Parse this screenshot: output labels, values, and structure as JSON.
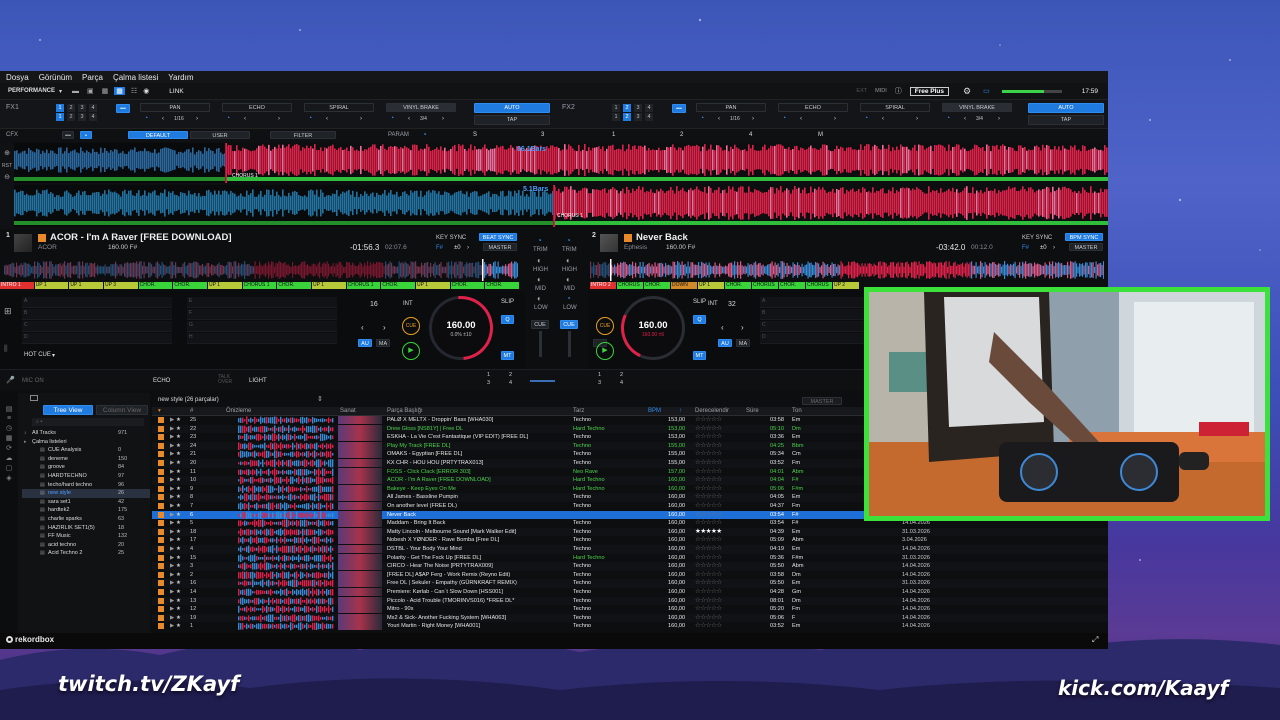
{
  "menu": [
    "Dosya",
    "Görünüm",
    "Parça",
    "Çalma listesi",
    "Yardım"
  ],
  "toolbar": {
    "mode": "PERFORMANCE",
    "link": "LINK",
    "free_plus": "Free Plus",
    "clock": "17:59",
    "midi": "MIDI",
    "ext": "EXT"
  },
  "fx1": {
    "label": "FX1",
    "effects": [
      "PAN",
      "ECHO",
      "SPIRAL",
      "VINYL BRAKE"
    ],
    "beat": "1/16",
    "beat2": "3/4",
    "auto": "AUTO",
    "tap": "TAP",
    "nums": [
      "1",
      "2",
      "3",
      "4",
      "1",
      "2",
      "3",
      "4"
    ]
  },
  "fx2": {
    "label": "FX2",
    "effects": [
      "PAN",
      "ECHO",
      "SPIRAL",
      "VINYL BRAKE"
    ],
    "beat": "1/16",
    "beat2": "3/4",
    "auto": "AUTO",
    "tap": "TAP"
  },
  "cfx": {
    "label": "CFX",
    "default": "DEFAULT",
    "user": "USER",
    "filter": "FILTER",
    "param": "PARAM",
    "s": "S",
    "m": "M",
    "nums": [
      "3",
      "1",
      "2",
      "4"
    ]
  },
  "waves": {
    "top_bars": "86.1Bars",
    "bot_bars": "5.1Bars",
    "top_chorus": "CHORUS 1",
    "bot_chorus": "CHORUS 1"
  },
  "deck1": {
    "num": "1",
    "title": "ACOR - I'm A Raver [FREE DOWNLOAD]",
    "artist": "ACOR",
    "bpm_key": "160.00 F#",
    "remain": "-01:56.3",
    "total": "02:07.6",
    "keysync": "KEY SYNC",
    "beatsync": "BEAT SYNC",
    "master": "MASTER",
    "bpm": "160.00",
    "pct": "0.0% ±10",
    "cue": "CUE",
    "loop": "16",
    "int": "INT",
    "slip": "SLIP",
    "q": "Q",
    "au": "AU",
    "ma": "MA",
    "mt": "MT",
    "hotcue": "HOT CUE"
  },
  "deck2": {
    "num": "2",
    "title": "Never Back",
    "artist": "Ephesis",
    "bpm_key": "160.00 F#",
    "remain": "-03:42.0",
    "total": "00:12.0",
    "keysync": "KEY SYNC",
    "beatsync": "BPM SYNC",
    "master": "MASTER",
    "bpm": "160.00",
    "pct": "160.00 ±6",
    "cue": "CUE",
    "loop": "32",
    "int": "INT",
    "slip": "SLIP",
    "q": "Q",
    "au": "AU",
    "ma": "MA",
    "mt": "MT"
  },
  "mixer": {
    "trim": "TRIM",
    "high": "HIGH",
    "mid": "MID",
    "low": "LOW",
    "cue": "CUE"
  },
  "cuebar1": [
    "INTRO 1",
    "UP 1",
    "UP 1",
    "UP 3",
    "CHOR.",
    "CHOR.",
    "UP 1",
    "CHORUS 1",
    "CHOR.",
    "UP 1",
    "CHORUS 1",
    "CHOR.",
    "UP 1",
    "CHOR.",
    "CHOR."
  ],
  "cuebar2": [
    "INTRO 2",
    "CHORUS 1",
    "CHOR.",
    "DOWN",
    "UP 1",
    "CHOR.",
    "CHORUS 1",
    "CHOR.",
    "CHORUS 1",
    "UP 2"
  ],
  "pads": {
    "left": [
      "A",
      "B",
      "C",
      "D"
    ],
    "left2": [
      "E",
      "F",
      "G",
      "H"
    ],
    "right": [
      "A",
      "B",
      "C",
      "D"
    ]
  },
  "bottomstrip": {
    "mic": "MIC ON",
    "echo": "ECHO",
    "light": "LIGHT",
    "talkover": "TALK OVER",
    "nums": [
      "1",
      "2",
      "3",
      "4",
      "1",
      "2",
      "3",
      "4"
    ]
  },
  "browser": {
    "tree_view": "Tree View",
    "column_view": "Column View",
    "playlist_title": "new style (26 parçalar)",
    "master": "MASTER",
    "headers": {
      "num": "#",
      "preview": "Önizleme",
      "artwork": "Sanat",
      "title": "Parça Başlığı",
      "genre": "Tarz",
      "bpm": "BPM",
      "rating": "Derecelendir",
      "time": "Süre",
      "key": "Ton"
    },
    "sidebar": [
      {
        "name": "All Tracks",
        "count": "971"
      },
      {
        "name": "Çalma listeleri",
        "count": ""
      },
      {
        "name": "CUE Analysis",
        "count": "0"
      },
      {
        "name": "deneme",
        "count": "150"
      },
      {
        "name": "groove",
        "count": "84"
      },
      {
        "name": "HARDTECHNO",
        "count": "97"
      },
      {
        "name": "techo/hard techno",
        "count": "96"
      },
      {
        "name": "new style",
        "count": "26"
      },
      {
        "name": "sara set1",
        "count": "42"
      },
      {
        "name": "hardtek2",
        "count": "175"
      },
      {
        "name": "charlie sparks",
        "count": "63"
      },
      {
        "name": "HAZIRLIK SET1(5)",
        "count": "18"
      },
      {
        "name": "FF Music",
        "count": "132"
      },
      {
        "name": "acid techno",
        "count": "20"
      },
      {
        "name": "Acid Techno 2",
        "count": "25"
      }
    ],
    "rows": [
      {
        "n": "25",
        "title": "PALØ X MELTX - Droppin' Bass [WHA030]",
        "genre": "Techno",
        "bpm": "153,00",
        "time": "03:58",
        "key": "Em",
        "date": "",
        "stars": 0,
        "c": "w"
      },
      {
        "n": "22",
        "title": "Drew Gloss [NS81Y] | Free DL",
        "genre": "Hard Techno",
        "bpm": "153,00",
        "time": "05:10",
        "key": "Dm",
        "date": "",
        "stars": 0,
        "c": "g"
      },
      {
        "n": "23",
        "title": "ESKHA - La Vie C'est Fantastique (VIP EDIT) [FREE DL]",
        "genre": "Techno",
        "bpm": "153,00",
        "time": "03:36",
        "key": "Em",
        "date": "",
        "stars": 0,
        "c": "w"
      },
      {
        "n": "24",
        "title": "Play My Track [FREE DL]",
        "genre": "Techno",
        "bpm": "155,00",
        "time": "04:25",
        "key": "Bbm",
        "date": "",
        "stars": 0,
        "c": "g"
      },
      {
        "n": "21",
        "title": "OMAKS - Egyptian [FREE DL]",
        "genre": "Techno",
        "bpm": "155,00",
        "time": "05:34",
        "key": "Cm",
        "date": "",
        "stars": 0,
        "c": "w"
      },
      {
        "n": "20",
        "title": "KX CHR - HOU HOU [PRTYTRAX013]",
        "genre": "Techno",
        "bpm": "155,00",
        "time": "03:52",
        "key": "Fm",
        "date": "",
        "stars": 0,
        "c": "w"
      },
      {
        "n": "11",
        "title": "FOSS - Click Clack [ERROR 303]",
        "genre": "Neo Rave",
        "bpm": "157,00",
        "time": "04:01",
        "key": "Abm",
        "date": "",
        "stars": 0,
        "c": "g"
      },
      {
        "n": "10",
        "title": "ACOR - I'm A Raver [FREE DOWNLOAD]",
        "genre": "Hard Techno",
        "bpm": "160,00",
        "time": "04:04",
        "key": "F#",
        "date": "",
        "stars": 0,
        "c": "g"
      },
      {
        "n": "9",
        "title": "Bakeye - Keep Eyes On Me",
        "genre": "Hard Techno",
        "bpm": "160,00",
        "time": "05:06",
        "key": "F#m",
        "date": "",
        "stars": 0,
        "c": "g"
      },
      {
        "n": "8",
        "title": "All James - Bassline Pumpin",
        "genre": "Techno",
        "bpm": "160,00",
        "time": "04:05",
        "key": "Em",
        "date": "",
        "stars": 0,
        "c": "w"
      },
      {
        "n": "7",
        "title": "On another level (FREE DL)",
        "genre": "Techno",
        "bpm": "160,00",
        "time": "04:37",
        "key": "Fm",
        "date": "",
        "stars": 0,
        "c": "w"
      },
      {
        "n": "6",
        "title": "Never Back",
        "genre": "",
        "bpm": "160,00",
        "time": "03:54",
        "key": "F#",
        "date": "",
        "stars": 0,
        "c": "sel"
      },
      {
        "n": "5",
        "title": "Maddam - Bring It Back",
        "genre": "Techno",
        "bpm": "160,00",
        "time": "03:54",
        "key": "F#",
        "date": "14.04.2026",
        "stars": 0,
        "c": "w"
      },
      {
        "n": "18",
        "title": "Matty Lincoln - Melbourne Sound [Mark Walker Edit]",
        "genre": "Techno",
        "bpm": "160,00",
        "time": "04:39",
        "key": "Em",
        "date": "31.03.2026",
        "stars": 5,
        "c": "w"
      },
      {
        "n": "17",
        "title": "Nobesh X YØNDER - Rave Bomba [Free DL]",
        "genre": "Techno",
        "bpm": "160,00",
        "time": "05:09",
        "key": "Abm",
        "date": "3.04.2026",
        "stars": 0,
        "c": "w"
      },
      {
        "n": "4",
        "title": "DSTBL - Your Body Your Mind",
        "genre": "Techno",
        "bpm": "160,00",
        "time": "04:19",
        "key": "Em",
        "date": "14.04.2026",
        "stars": 0,
        "c": "w"
      },
      {
        "n": "15",
        "title": "Polarity - Get The Fxck Up [FREE DL]",
        "genre": "Hard Techno",
        "bpm": "160,00",
        "time": "05:36",
        "key": "F#m",
        "date": "31.03.2026",
        "stars": 0,
        "c": "w"
      },
      {
        "n": "3",
        "title": "CIRCO - Hear The Noise [PRTYTRAX009]",
        "genre": "Techno",
        "bpm": "160,00",
        "time": "05:50",
        "key": "Abm",
        "date": "14.04.2026",
        "stars": 0,
        "c": "w"
      },
      {
        "n": "2",
        "title": "[FREE DL] A$AP Ferg - Work Remix (Reyno Edit)",
        "genre": "Techno",
        "bpm": "160,00",
        "time": "03:58",
        "key": "Dm",
        "date": "14.04.2026",
        "stars": 0,
        "c": "w"
      },
      {
        "n": "16",
        "title": "Free DL | Sekuler - Empathy (GÜRNKRAFT REMIX)",
        "genre": "Techno",
        "bpm": "160,00",
        "time": "05:50",
        "key": "Em",
        "date": "31.03.2026",
        "stars": 0,
        "c": "w"
      },
      {
        "n": "14",
        "title": "Premiere: Kørlab - Can´t Slow Down [HSS001]",
        "genre": "Techno",
        "bpm": "160,00",
        "time": "04:28",
        "key": "Gm",
        "date": "14.04.2026",
        "stars": 0,
        "c": "w"
      },
      {
        "n": "13",
        "title": "Piccolo - Acid Trouble (TMORINVS016) *FREE DL*",
        "genre": "Techno",
        "bpm": "160,00",
        "time": "08:01",
        "key": "Dm",
        "date": "14.04.2026",
        "stars": 0,
        "c": "w"
      },
      {
        "n": "12",
        "title": "Mitro - 90s",
        "genre": "Techno",
        "bpm": "160,00",
        "time": "05:20",
        "key": "Fm",
        "date": "14.04.2026",
        "stars": 0,
        "c": "w"
      },
      {
        "n": "19",
        "title": "Mx2 & Sick- Another Fucking System [WHA063]",
        "genre": "Techno",
        "bpm": "160,00",
        "time": "05:06",
        "key": "F",
        "date": "14.04.2026",
        "stars": 0,
        "c": "w"
      },
      {
        "n": "1",
        "title": "Youri Martin - Right Money [WHA001]",
        "genre": "Techno",
        "bpm": "160,00",
        "time": "03:52",
        "key": "Em",
        "date": "14.04.2026",
        "stars": 0,
        "c": "w"
      }
    ]
  },
  "footer": {
    "logo": "rekordbox"
  },
  "overlays": {
    "twitch": "twitch.tv/ZKayf",
    "kick": "kick.com/Kaayf"
  },
  "colors": {
    "accent": "#1f7be0",
    "cue_orange": "#e8a020",
    "green": "#39d43a",
    "selected_row": "#1f6fd8",
    "red_wave": "#e0214a"
  }
}
